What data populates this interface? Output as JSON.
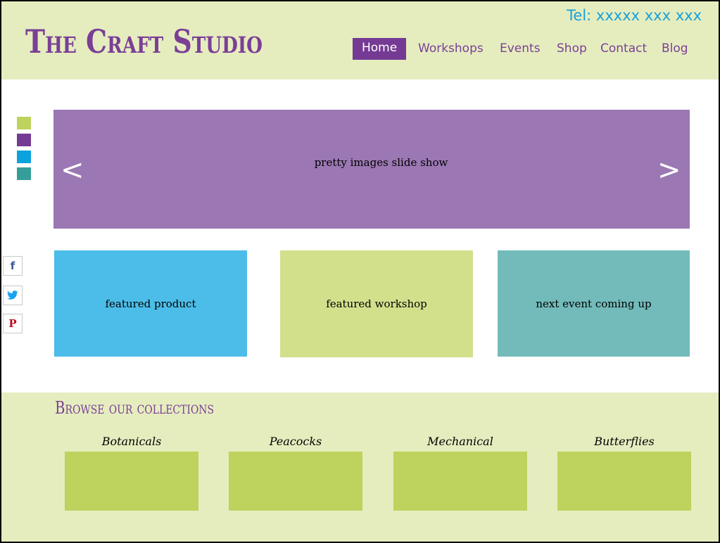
{
  "header": {
    "logo": "The Craft Studio",
    "tel": "Tel: xxxxx xxx xxx"
  },
  "nav": {
    "items": [
      {
        "label": "Home",
        "active": true
      },
      {
        "label": "Workshops",
        "active": false
      },
      {
        "label": "Events",
        "active": false
      },
      {
        "label": "Shop",
        "active": false
      },
      {
        "label": "Contact",
        "active": false
      },
      {
        "label": "Blog",
        "active": false
      }
    ]
  },
  "swatches": {
    "colors": [
      "#bdd35e",
      "#743a94",
      "#0ba2de",
      "#369e99"
    ]
  },
  "hero": {
    "text": "pretty images slide show",
    "prev": "<",
    "next": ">",
    "color": "#9b77b3"
  },
  "social": {
    "icons": [
      "facebook-icon",
      "twitter-icon",
      "pinterest-icon"
    ]
  },
  "cards": [
    {
      "label": "featured product",
      "color": "#4cbde9"
    },
    {
      "label": "featured workshop",
      "color": "#d2e08c"
    },
    {
      "label": "next event coming up",
      "color": "#72bbba"
    }
  ],
  "collections": {
    "title": "Browse our collections",
    "items": [
      {
        "label": "Botanicals"
      },
      {
        "label": "Peacocks"
      },
      {
        "label": "Mechanical"
      },
      {
        "label": "Butterflies"
      }
    ]
  },
  "colors": {
    "accent_purple": "#7b3f95",
    "header_bg": "#e5edbf",
    "tel_blue": "#1ba0d8"
  }
}
